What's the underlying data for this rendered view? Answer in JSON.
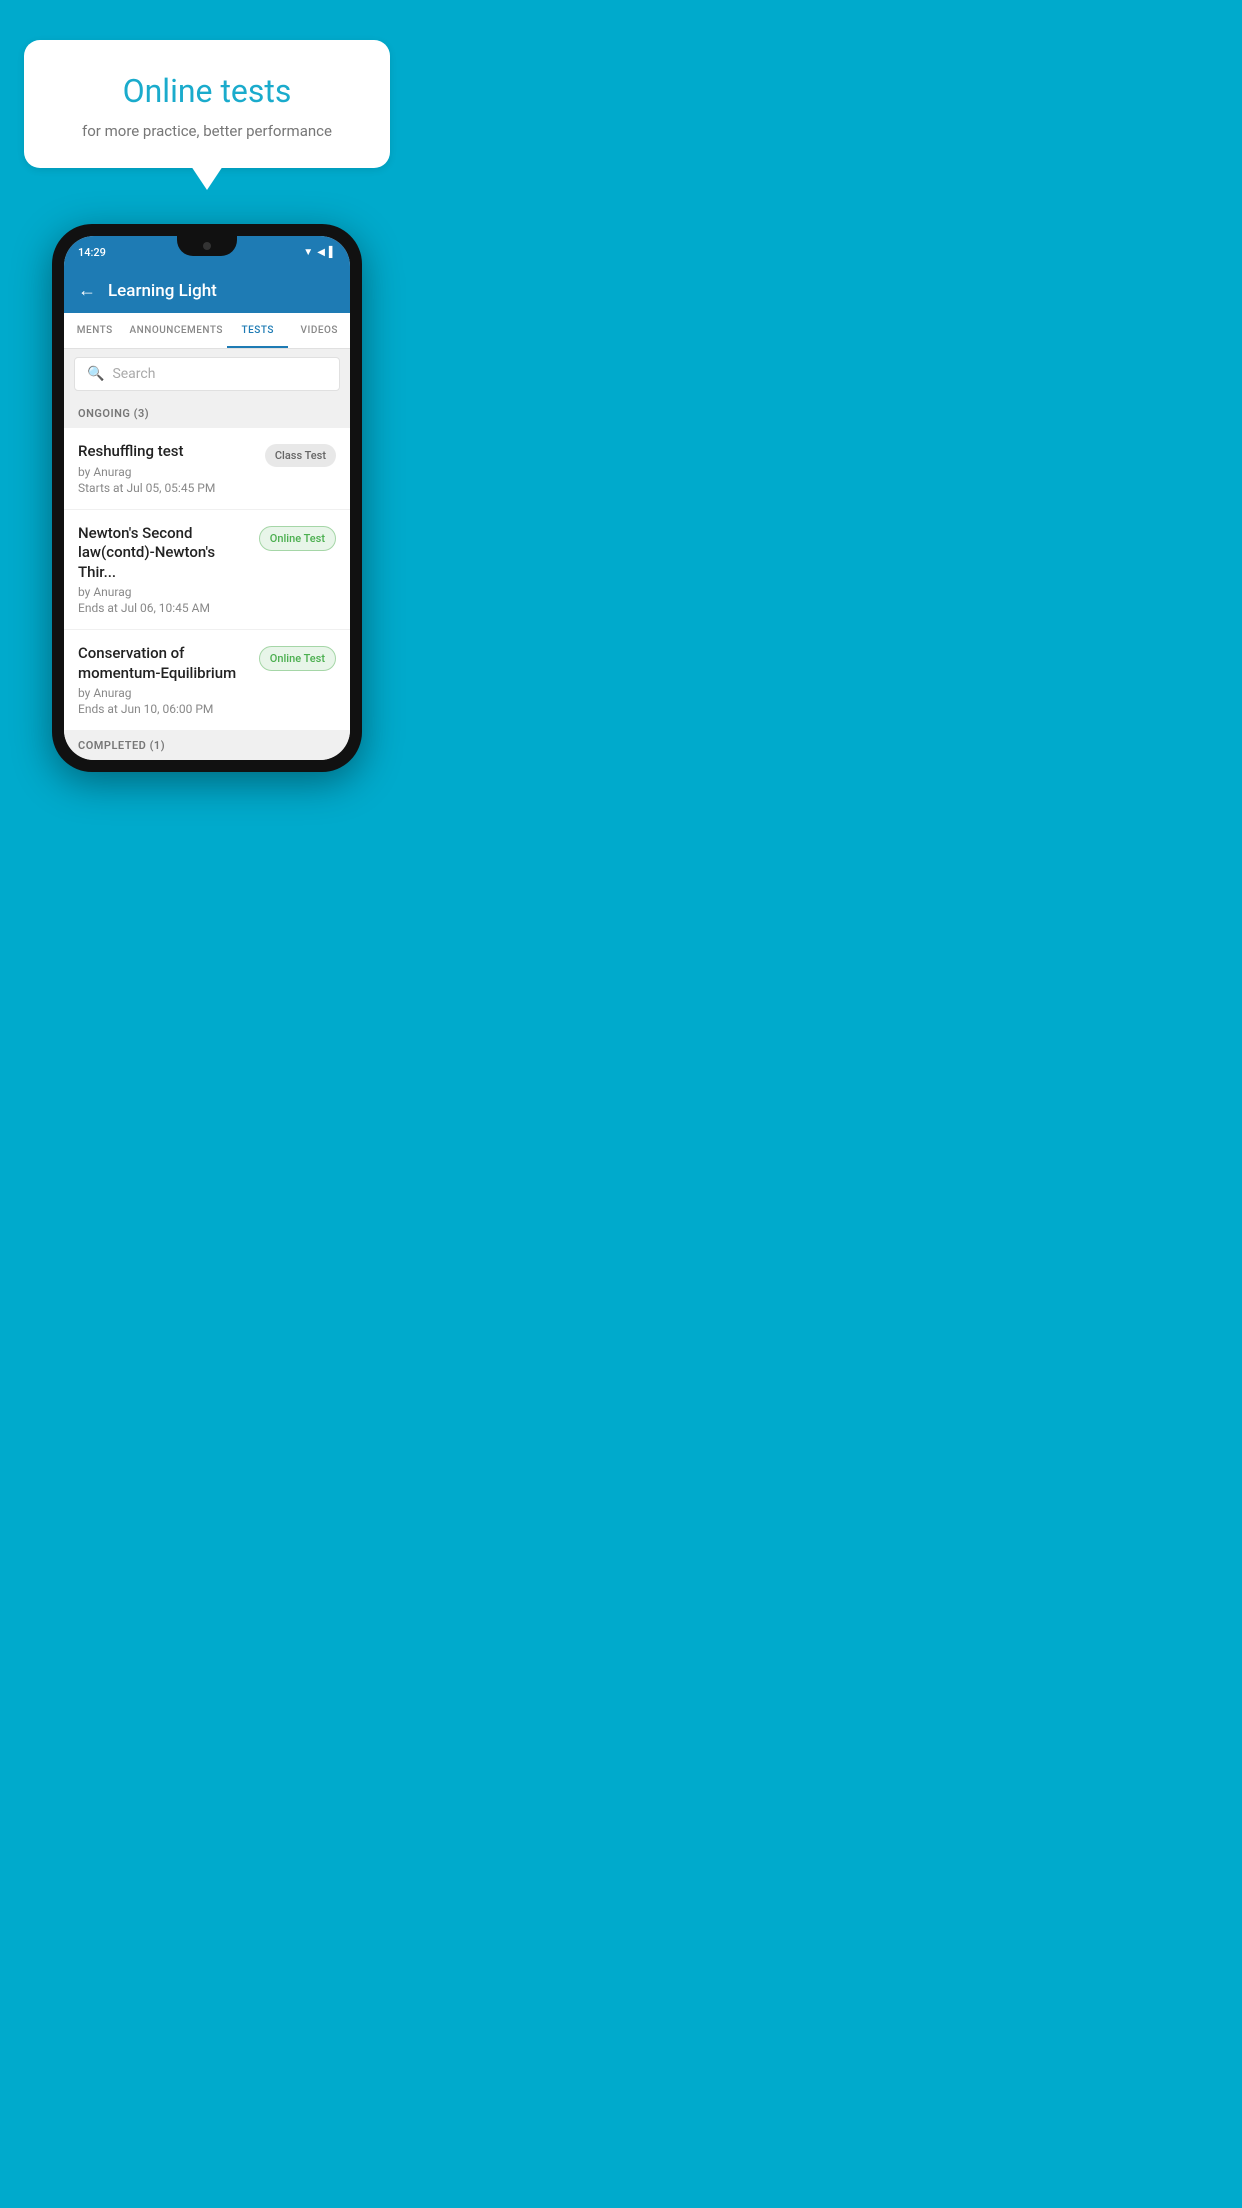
{
  "background_color": "#00AACC",
  "promo": {
    "title": "Online tests",
    "subtitle": "for more practice, better performance"
  },
  "phone": {
    "status_bar": {
      "time": "14:29",
      "icons": [
        "▼",
        "◀",
        "▌"
      ]
    },
    "header": {
      "title": "Learning Light",
      "back_label": "←"
    },
    "tabs": [
      {
        "label": "MENTS",
        "active": false
      },
      {
        "label": "ANNOUNCEMENTS",
        "active": false
      },
      {
        "label": "TESTS",
        "active": true
      },
      {
        "label": "VIDEOS",
        "active": false
      }
    ],
    "search": {
      "placeholder": "Search",
      "icon": "🔍"
    },
    "ongoing_section": {
      "label": "ONGOING (3)"
    },
    "tests": [
      {
        "name": "Reshuffling test",
        "author": "by Anurag",
        "date_label": "Starts at",
        "date": "Jul 05, 05:45 PM",
        "badge": "Class Test",
        "badge_type": "class"
      },
      {
        "name": "Newton's Second law(contd)-Newton's Thir...",
        "author": "by Anurag",
        "date_label": "Ends at",
        "date": "Jul 06, 10:45 AM",
        "badge": "Online Test",
        "badge_type": "online"
      },
      {
        "name": "Conservation of momentum-Equilibrium",
        "author": "by Anurag",
        "date_label": "Ends at",
        "date": "Jun 10, 06:00 PM",
        "badge": "Online Test",
        "badge_type": "online"
      }
    ],
    "completed_section": {
      "label": "COMPLETED (1)"
    }
  }
}
